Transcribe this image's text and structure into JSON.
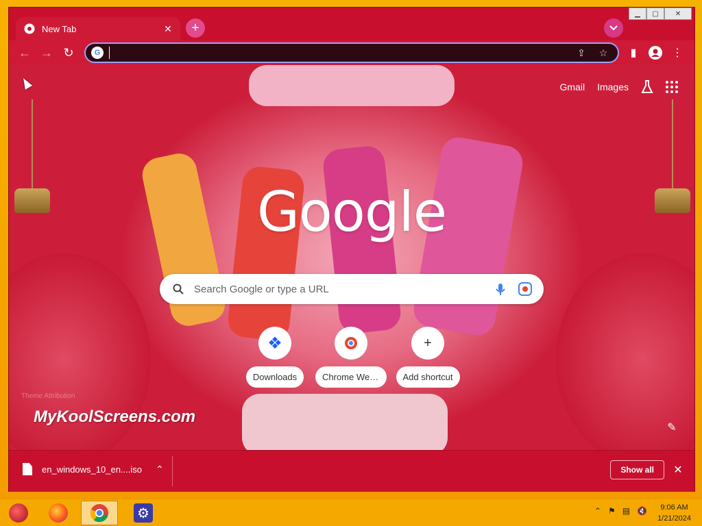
{
  "browser": {
    "tab": {
      "title": "New Tab",
      "favicon": "chrome-icon"
    },
    "window_controls": [
      "minimize",
      "maximize",
      "close"
    ],
    "toolbar": {
      "back_icon": "arrow-left-icon",
      "forward_icon": "arrow-right-icon",
      "reload_icon": "reload-icon",
      "omnibox_value": "",
      "share_icon": "share-icon",
      "bookmark_icon": "star-icon",
      "side_panel_icon": "side-panel-icon",
      "profile_icon": "profile-icon",
      "menu_icon": "kebab-menu-icon"
    }
  },
  "ntp": {
    "links": {
      "gmail": "Gmail",
      "images": "Images"
    },
    "logo": "Google",
    "search_placeholder": "Search Google or type a URL",
    "shortcuts": [
      {
        "label": "Downloads",
        "icon": "downloads-shortcut-icon"
      },
      {
        "label": "Chrome Web ...",
        "icon": "chrome-web-store-icon"
      },
      {
        "label": "Add shortcut",
        "icon": "plus-icon"
      }
    ],
    "watermark": "MyKoolScreens.com",
    "theme_credit": "Theme Attribution"
  },
  "download_shelf": {
    "file_name": "en_windows_10_en....iso",
    "show_all": "Show all"
  },
  "taskbar": {
    "time": "9:06 AM",
    "date": "1/21/2024"
  },
  "colors": {
    "theme_red": "#c8102e",
    "accent_pink": "#e24b8c",
    "taskbar": "#f5a900"
  }
}
